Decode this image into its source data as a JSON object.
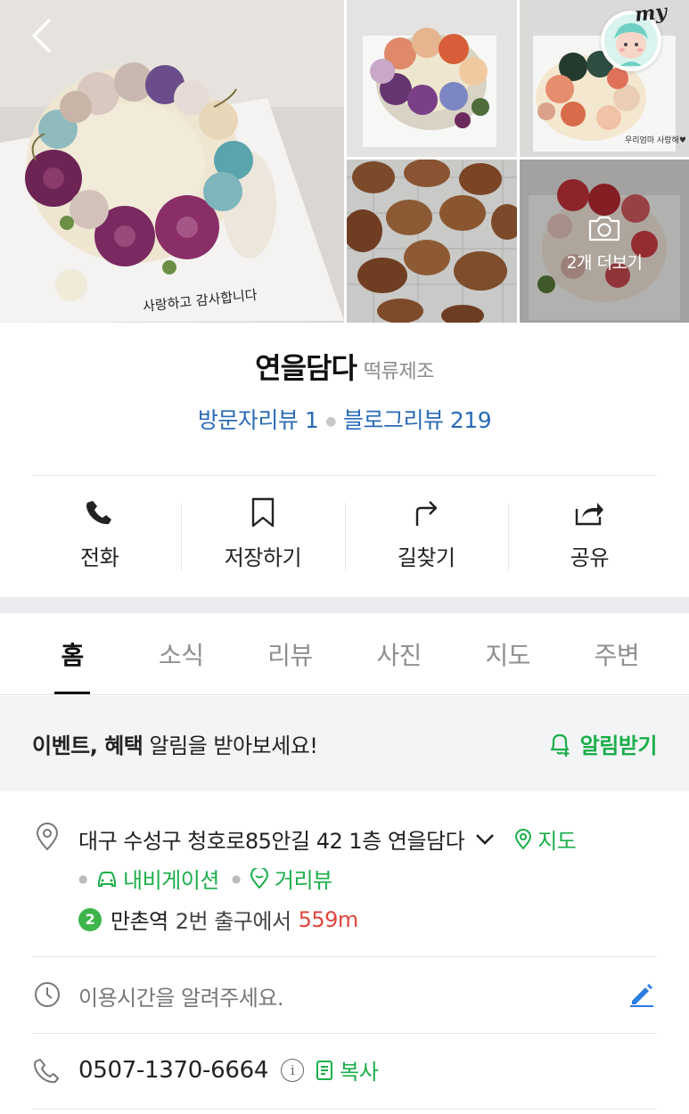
{
  "gallery": {
    "more_label": "2개 더보기",
    "main_cake_text": "사랑하고 감사합니다",
    "cake2_text": "우리엄마 사랑해♥",
    "my_label": "my"
  },
  "place": {
    "name": "연을담다",
    "category": "떡류제조",
    "visitor_review_label": "방문자리뷰 1",
    "blog_review_label": "블로그리뷰 219"
  },
  "actions": [
    {
      "label": "전화",
      "icon": "phone-icon"
    },
    {
      "label": "저장하기",
      "icon": "bookmark-icon"
    },
    {
      "label": "길찾기",
      "icon": "directions-icon"
    },
    {
      "label": "공유",
      "icon": "share-icon"
    }
  ],
  "tabs": [
    {
      "label": "홈",
      "active": true
    },
    {
      "label": "소식",
      "active": false
    },
    {
      "label": "리뷰",
      "active": false
    },
    {
      "label": "사진",
      "active": false
    },
    {
      "label": "지도",
      "active": false
    },
    {
      "label": "주변",
      "active": false
    }
  ],
  "event": {
    "bold_text": "이벤트, 혜택",
    "text": " 알림을 받아보세요!",
    "button_label": "알림받기"
  },
  "address": {
    "text": "대구 수성구 청호로85안길 42 1층 연을담다",
    "map_label": "지도",
    "navigation_label": "내비게이션",
    "streetview_label": "거리뷰",
    "subway_line": "2",
    "station": "만촌역",
    "exit_text": "2번 출구에서",
    "distance": "559m"
  },
  "hours": {
    "placeholder": "이용시간을 알려주세요."
  },
  "phone": {
    "number": "0507-1370-6664",
    "copy_label": "복사"
  },
  "colors": {
    "link_blue": "#2a6bb6",
    "naver_green": "#1aae4a",
    "distance_red": "#e0463c",
    "subway_line2_green": "#3db54a"
  }
}
